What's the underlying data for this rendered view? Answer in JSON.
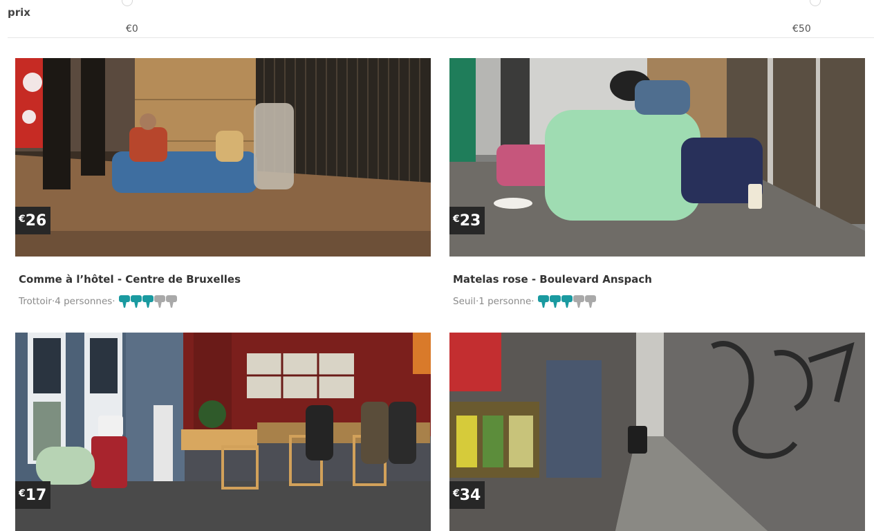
{
  "filter": {
    "label": "prix",
    "min": "€0",
    "max": "€50"
  },
  "colors": {
    "rating_active": "#1a9aa0",
    "rating_inactive": "#a9a9a9",
    "badge_bg": "#272727"
  },
  "cards": [
    {
      "price_symbol": "€",
      "price": "26",
      "title": "Comme à l’hôtel - Centre de Bruxelles",
      "type": "Trottoir",
      "people": "4 personnes",
      "rating": 3,
      "rating_max": 5
    },
    {
      "price_symbol": "€",
      "price": "23",
      "title": "Matelas rose - Boulevard Anspach",
      "type": "Seuil",
      "people": "1 personne",
      "rating": 3,
      "rating_max": 5
    },
    {
      "price_symbol": "€",
      "price": "17",
      "title": "",
      "type": "",
      "people": "",
      "rating": 0,
      "rating_max": 5
    },
    {
      "price_symbol": "€",
      "price": "34",
      "title": "",
      "type": "",
      "people": "",
      "rating": 0,
      "rating_max": 5
    }
  ]
}
